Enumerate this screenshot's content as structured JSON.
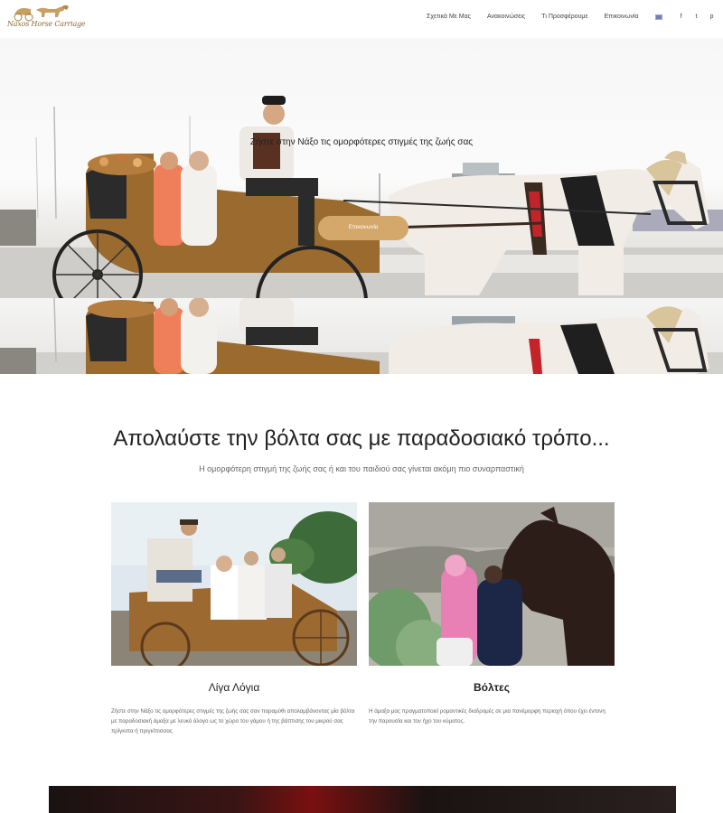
{
  "header": {
    "logo_text": "Naxos Horse Carriage",
    "nav": [
      {
        "label": "Σχετικά Με Μας"
      },
      {
        "label": "Ανακοινώσεις"
      },
      {
        "label": "Τι Προσφέρουμε"
      },
      {
        "label": "Επικοινωνία"
      }
    ],
    "social": {
      "facebook": "f",
      "twitter": "t",
      "pinterest": "p"
    }
  },
  "hero": {
    "title": "Ζήστε στην Νάξο τις ομορφότερες στιγμές της ζωής σας",
    "button_label": "Επικοινωνία"
  },
  "intro": {
    "title": "Απολαύστε την βόλτα σας με παραδοσιακό τρόπο...",
    "subtitle": "Η ομορφότερη στιγμή της ζωής σας ή και του παιδιού σας γίνεται ακόμη πιο συναρπαστική"
  },
  "cards": [
    {
      "title": "Λίγα Λόγια",
      "text": "Ζήστε στην Νάξο τις ομορφότερες στιγμές της ζωής σας σαν παραμύθι απολαμβάνοντας μία βόλτα με παραδοσιακή άμαξα με λευκό άλογο ως το χώρο του γάμου ή της βάπτισης του μικρού σας πρίγκιπα ή πριγκίπισσας"
    },
    {
      "title": "Βόλτες",
      "text": "Η άμαξα μας πραγματοποιεί ρομαντικές διαδρομές σε μια πανέμορφη περιοχή όπου έχει έντονη την παρουσία και τον ήχο του κύματος."
    }
  ],
  "colors": {
    "accent": "#d4a86b",
    "text_dark": "#222222",
    "text_muted": "#666666"
  }
}
